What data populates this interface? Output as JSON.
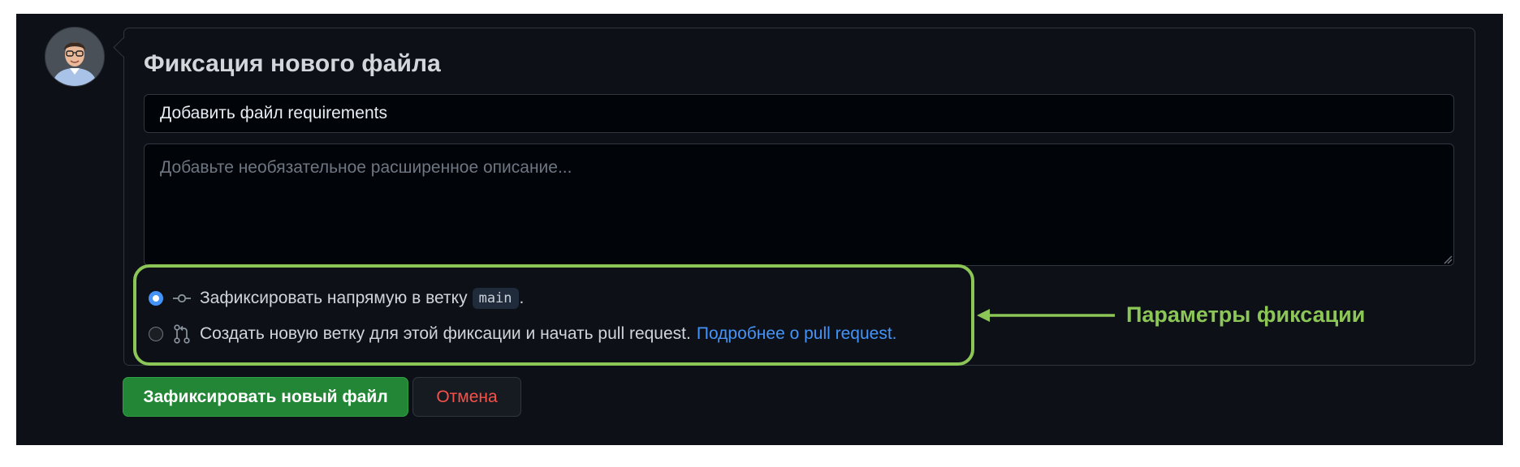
{
  "commit_form": {
    "title": "Фиксация нового файла",
    "summary_value": "Добавить файл requirements",
    "description_placeholder": "Добавьте необязательное расширенное описание...",
    "options": [
      {
        "label": "Зафиксировать напрямую в ветку",
        "branch": "main",
        "suffix": ".",
        "icon": "git-commit-icon",
        "checked": true
      },
      {
        "label": "Создать новую ветку для этой фиксации и начать pull request.",
        "link_text": "Подробнее о pull request.",
        "icon": "git-pull-request-icon",
        "checked": false
      }
    ],
    "commit_button_label": "Зафиксировать новый файл",
    "cancel_button_label": "Отмена"
  },
  "annotation": {
    "label": "Параметры фиксации",
    "color": "#8cc657"
  },
  "colors": {
    "background": "#0d1117",
    "primary_button": "#238636",
    "link": "#4493f8",
    "danger_text": "#f85149"
  }
}
